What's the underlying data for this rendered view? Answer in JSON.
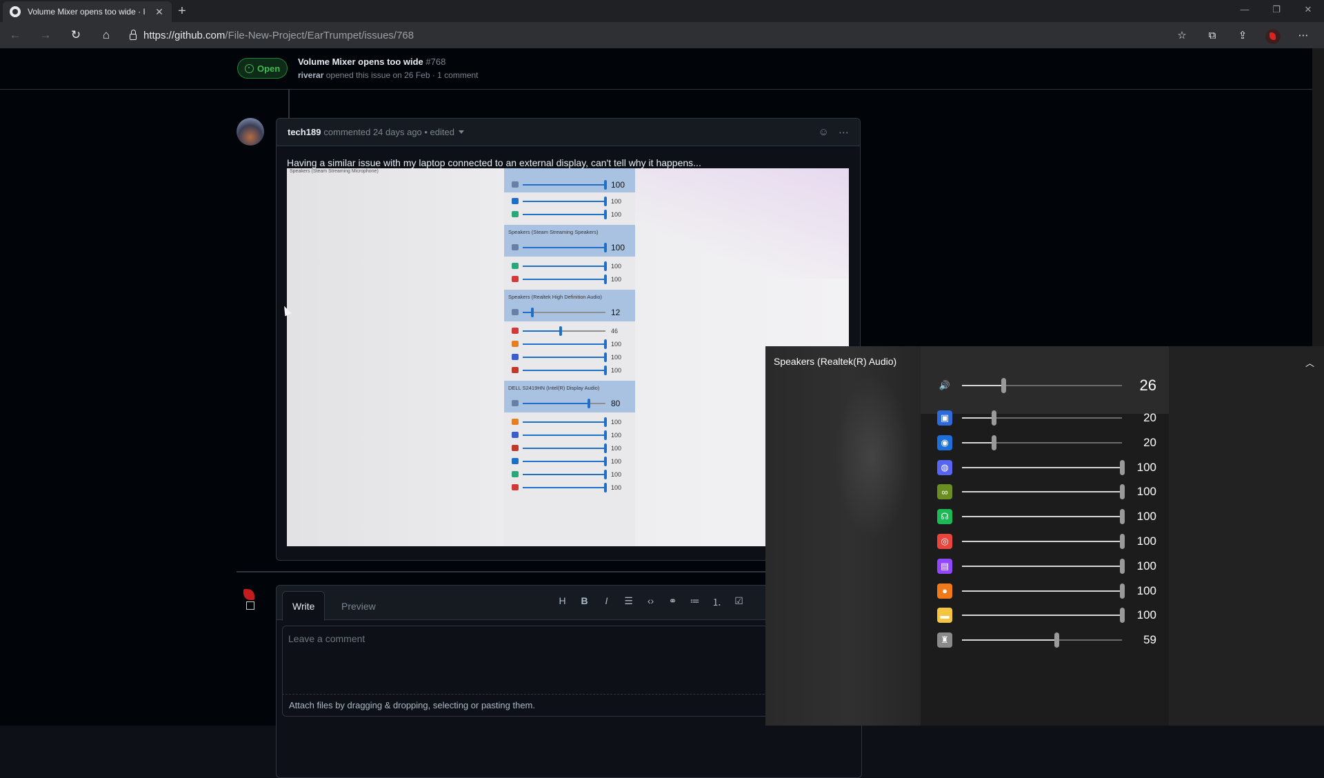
{
  "browser": {
    "tab_title": "Volume Mixer opens too wide · I",
    "url_host": "https://github.com",
    "url_path": "/File-New-Project/EarTrumpet/issues/768"
  },
  "issue": {
    "state": "Open",
    "title": "Volume Mixer opens too wide",
    "number": "#768",
    "author": "riverar",
    "meta": "opened this issue on 26 Feb · 1 comment"
  },
  "comment": {
    "author": "tech189",
    "meta": "commented 24 days ago • edited",
    "body": "Having a similar issue with my laptop connected to an external display, can't tell why it happens..."
  },
  "screenshot_mixer": {
    "top_label": "Speakers (Steam Streaming Microphone)",
    "devices": [
      {
        "name": "",
        "value": "100",
        "apps": [
          "100",
          "100"
        ]
      },
      {
        "name": "Speakers (Steam Streaming Speakers)",
        "value": "100",
        "apps": [
          "100",
          "100"
        ]
      },
      {
        "name": "Speakers (Realtek High Definition Audio)",
        "value": "12",
        "apps": [
          "46",
          "100",
          "100",
          "100"
        ]
      },
      {
        "name": "DELL S2419HN (Intel(R) Display Audio)",
        "value": "80",
        "apps": [
          "100",
          "100",
          "100",
          "100",
          "100",
          "100"
        ]
      }
    ]
  },
  "editor": {
    "tab_write": "Write",
    "tab_preview": "Preview",
    "placeholder": "Leave a comment",
    "attach_hint": "Attach files by dragging & dropping, selecting or pasting them."
  },
  "flyout": {
    "device_name": "Speakers (Realtek(R) Audio)",
    "device_volume": "26",
    "apps": [
      {
        "icon": "monitor-app-icon",
        "value": "20",
        "color": "#2f6bd8"
      },
      {
        "icon": "media-player-icon",
        "value": "20",
        "color": "#1e6fd9"
      },
      {
        "icon": "discord-icon",
        "value": "100",
        "color": "#5865f2"
      },
      {
        "icon": "minecraft-icon",
        "value": "100",
        "color": "#6b8e23"
      },
      {
        "icon": "headset-icon",
        "value": "100",
        "color": "#1db954"
      },
      {
        "icon": "browser-icon",
        "value": "100",
        "color": "#e8453c"
      },
      {
        "icon": "twitch-icon",
        "value": "100",
        "color": "#9146ff"
      },
      {
        "icon": "microphone-icon",
        "value": "100",
        "color": "#f07a1a"
      },
      {
        "icon": "folder-icon",
        "value": "100",
        "color": "#f5c542"
      },
      {
        "icon": "game-icon",
        "value": "59",
        "color": "#8a8a8a"
      }
    ]
  }
}
